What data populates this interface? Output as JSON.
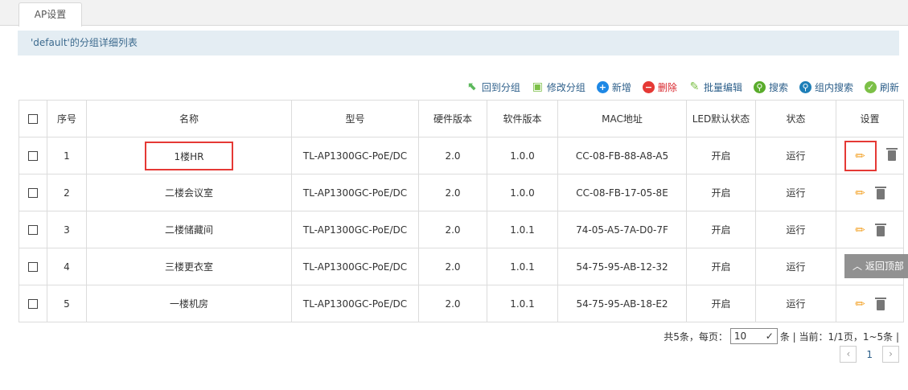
{
  "tab": "AP设置",
  "group_title": "'default'的分组详细列表",
  "toolbar": [
    {
      "label": "回到分组",
      "icon": "back-arrow-icon",
      "color": "#5cb85c"
    },
    {
      "label": "修改分组",
      "icon": "edit-group-icon",
      "color": "#7cc047"
    },
    {
      "label": "新增",
      "icon": "plus-circle-icon",
      "color": "#1e88e5"
    },
    {
      "label": "删除",
      "icon": "minus-circle-icon",
      "color": "#e53935"
    },
    {
      "label": "批量编辑",
      "icon": "batch-edit-icon",
      "color": "#7cc047"
    },
    {
      "label": "搜索",
      "icon": "search-icon",
      "color": "#5aac2c"
    },
    {
      "label": "组内搜索",
      "icon": "group-search-icon",
      "color": "#1e7fb8"
    },
    {
      "label": "刷新",
      "icon": "refresh-icon",
      "color": "#7cc047"
    }
  ],
  "columns": [
    "序号",
    "名称",
    "型号",
    "硬件版本",
    "软件版本",
    "MAC地址",
    "LED默认状态",
    "状态",
    "设置"
  ],
  "rows": [
    {
      "no": "1",
      "name": "1楼HR",
      "model": "TL-AP1300GC-PoE/DC",
      "hw": "2.0",
      "sw": "1.0.0",
      "mac": "CC-08-FB-88-A8-A5",
      "led": "开启",
      "status": "运行"
    },
    {
      "no": "2",
      "name": "二楼会议室",
      "model": "TL-AP1300GC-PoE/DC",
      "hw": "2.0",
      "sw": "1.0.0",
      "mac": "CC-08-FB-17-05-8E",
      "led": "开启",
      "status": "运行"
    },
    {
      "no": "3",
      "name": "二楼储藏间",
      "model": "TL-AP1300GC-PoE/DC",
      "hw": "2.0",
      "sw": "1.0.1",
      "mac": "74-05-A5-7A-D0-7F",
      "led": "开启",
      "status": "运行"
    },
    {
      "no": "4",
      "name": "三楼更衣室",
      "model": "TL-AP1300GC-PoE/DC",
      "hw": "2.0",
      "sw": "1.0.1",
      "mac": "54-75-95-AB-12-32",
      "led": "开启",
      "status": "运行"
    },
    {
      "no": "5",
      "name": "一楼机房",
      "model": "TL-AP1300GC-PoE/DC",
      "hw": "2.0",
      "sw": "1.0.1",
      "mac": "54-75-95-AB-18-E2",
      "led": "开启",
      "status": "运行"
    }
  ],
  "pagination": {
    "total": "共5条，每页：",
    "per_page": "10",
    "unit": "条 | 当前：1/1页，1~5条 |",
    "current_page": "1",
    "prev": "‹",
    "next": "›"
  },
  "back_to_top": "返回顶部"
}
